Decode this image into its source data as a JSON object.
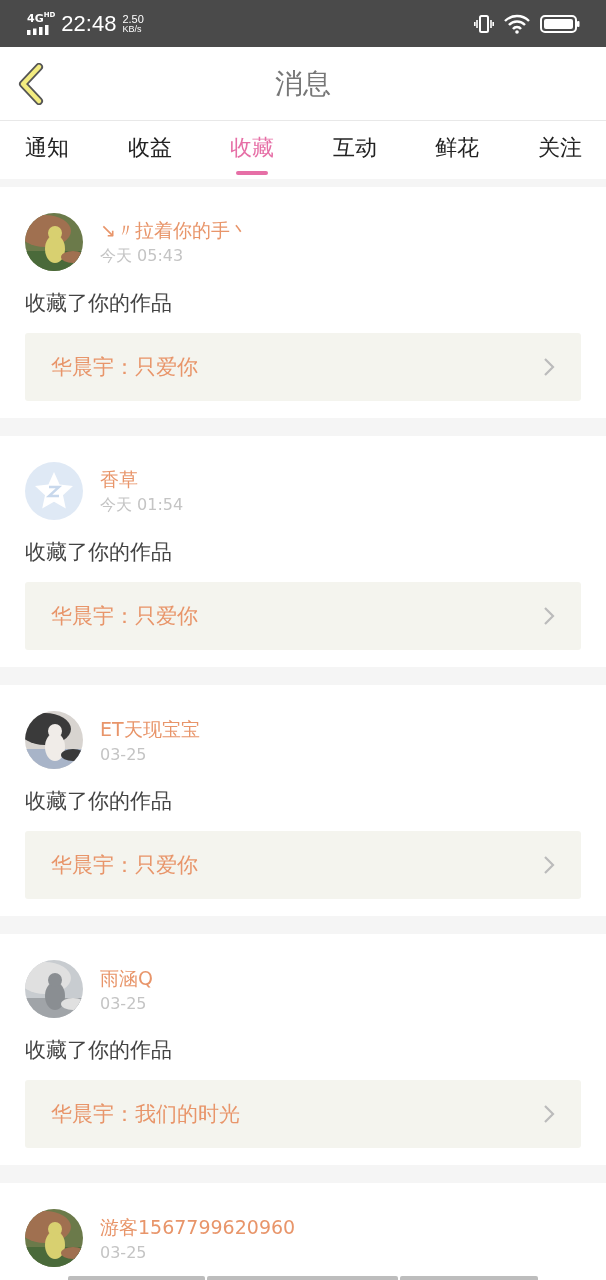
{
  "status_bar": {
    "network": "4G",
    "network_sup": "HD",
    "time": "22:48",
    "speed_value": "2.50",
    "speed_unit": "KB/s"
  },
  "header": {
    "title": "消息"
  },
  "tabs": [
    {
      "label": "通知",
      "selected": false
    },
    {
      "label": "收益",
      "selected": false
    },
    {
      "label": "收藏",
      "selected": true
    },
    {
      "label": "互动",
      "selected": false
    },
    {
      "label": "鲜花",
      "selected": false
    },
    {
      "label": "关注",
      "selected": false
    }
  ],
  "messages": [
    {
      "name": "↘〃拉着你的手丶",
      "time": "今天 05:43",
      "action": "收藏了你的作品",
      "work": "华晨宇：只爱你"
    },
    {
      "avatar": {
        "kind": "default"
      },
      "name": "香草",
      "time": "今天 01:54",
      "action": "收藏了你的作品",
      "work": "华晨宇：只爱你"
    },
    {
      "name": "ET天现宝宝",
      "time": "03-25",
      "action": "收藏了你的作品",
      "work": "华晨宇：只爱你"
    },
    {
      "name": "雨涵Q",
      "time": "03-25",
      "action": "收藏了你的作品",
      "work": "华晨宇：我们的时光"
    },
    {
      "name": "游客1567799620960",
      "time": "03-25"
    }
  ]
}
